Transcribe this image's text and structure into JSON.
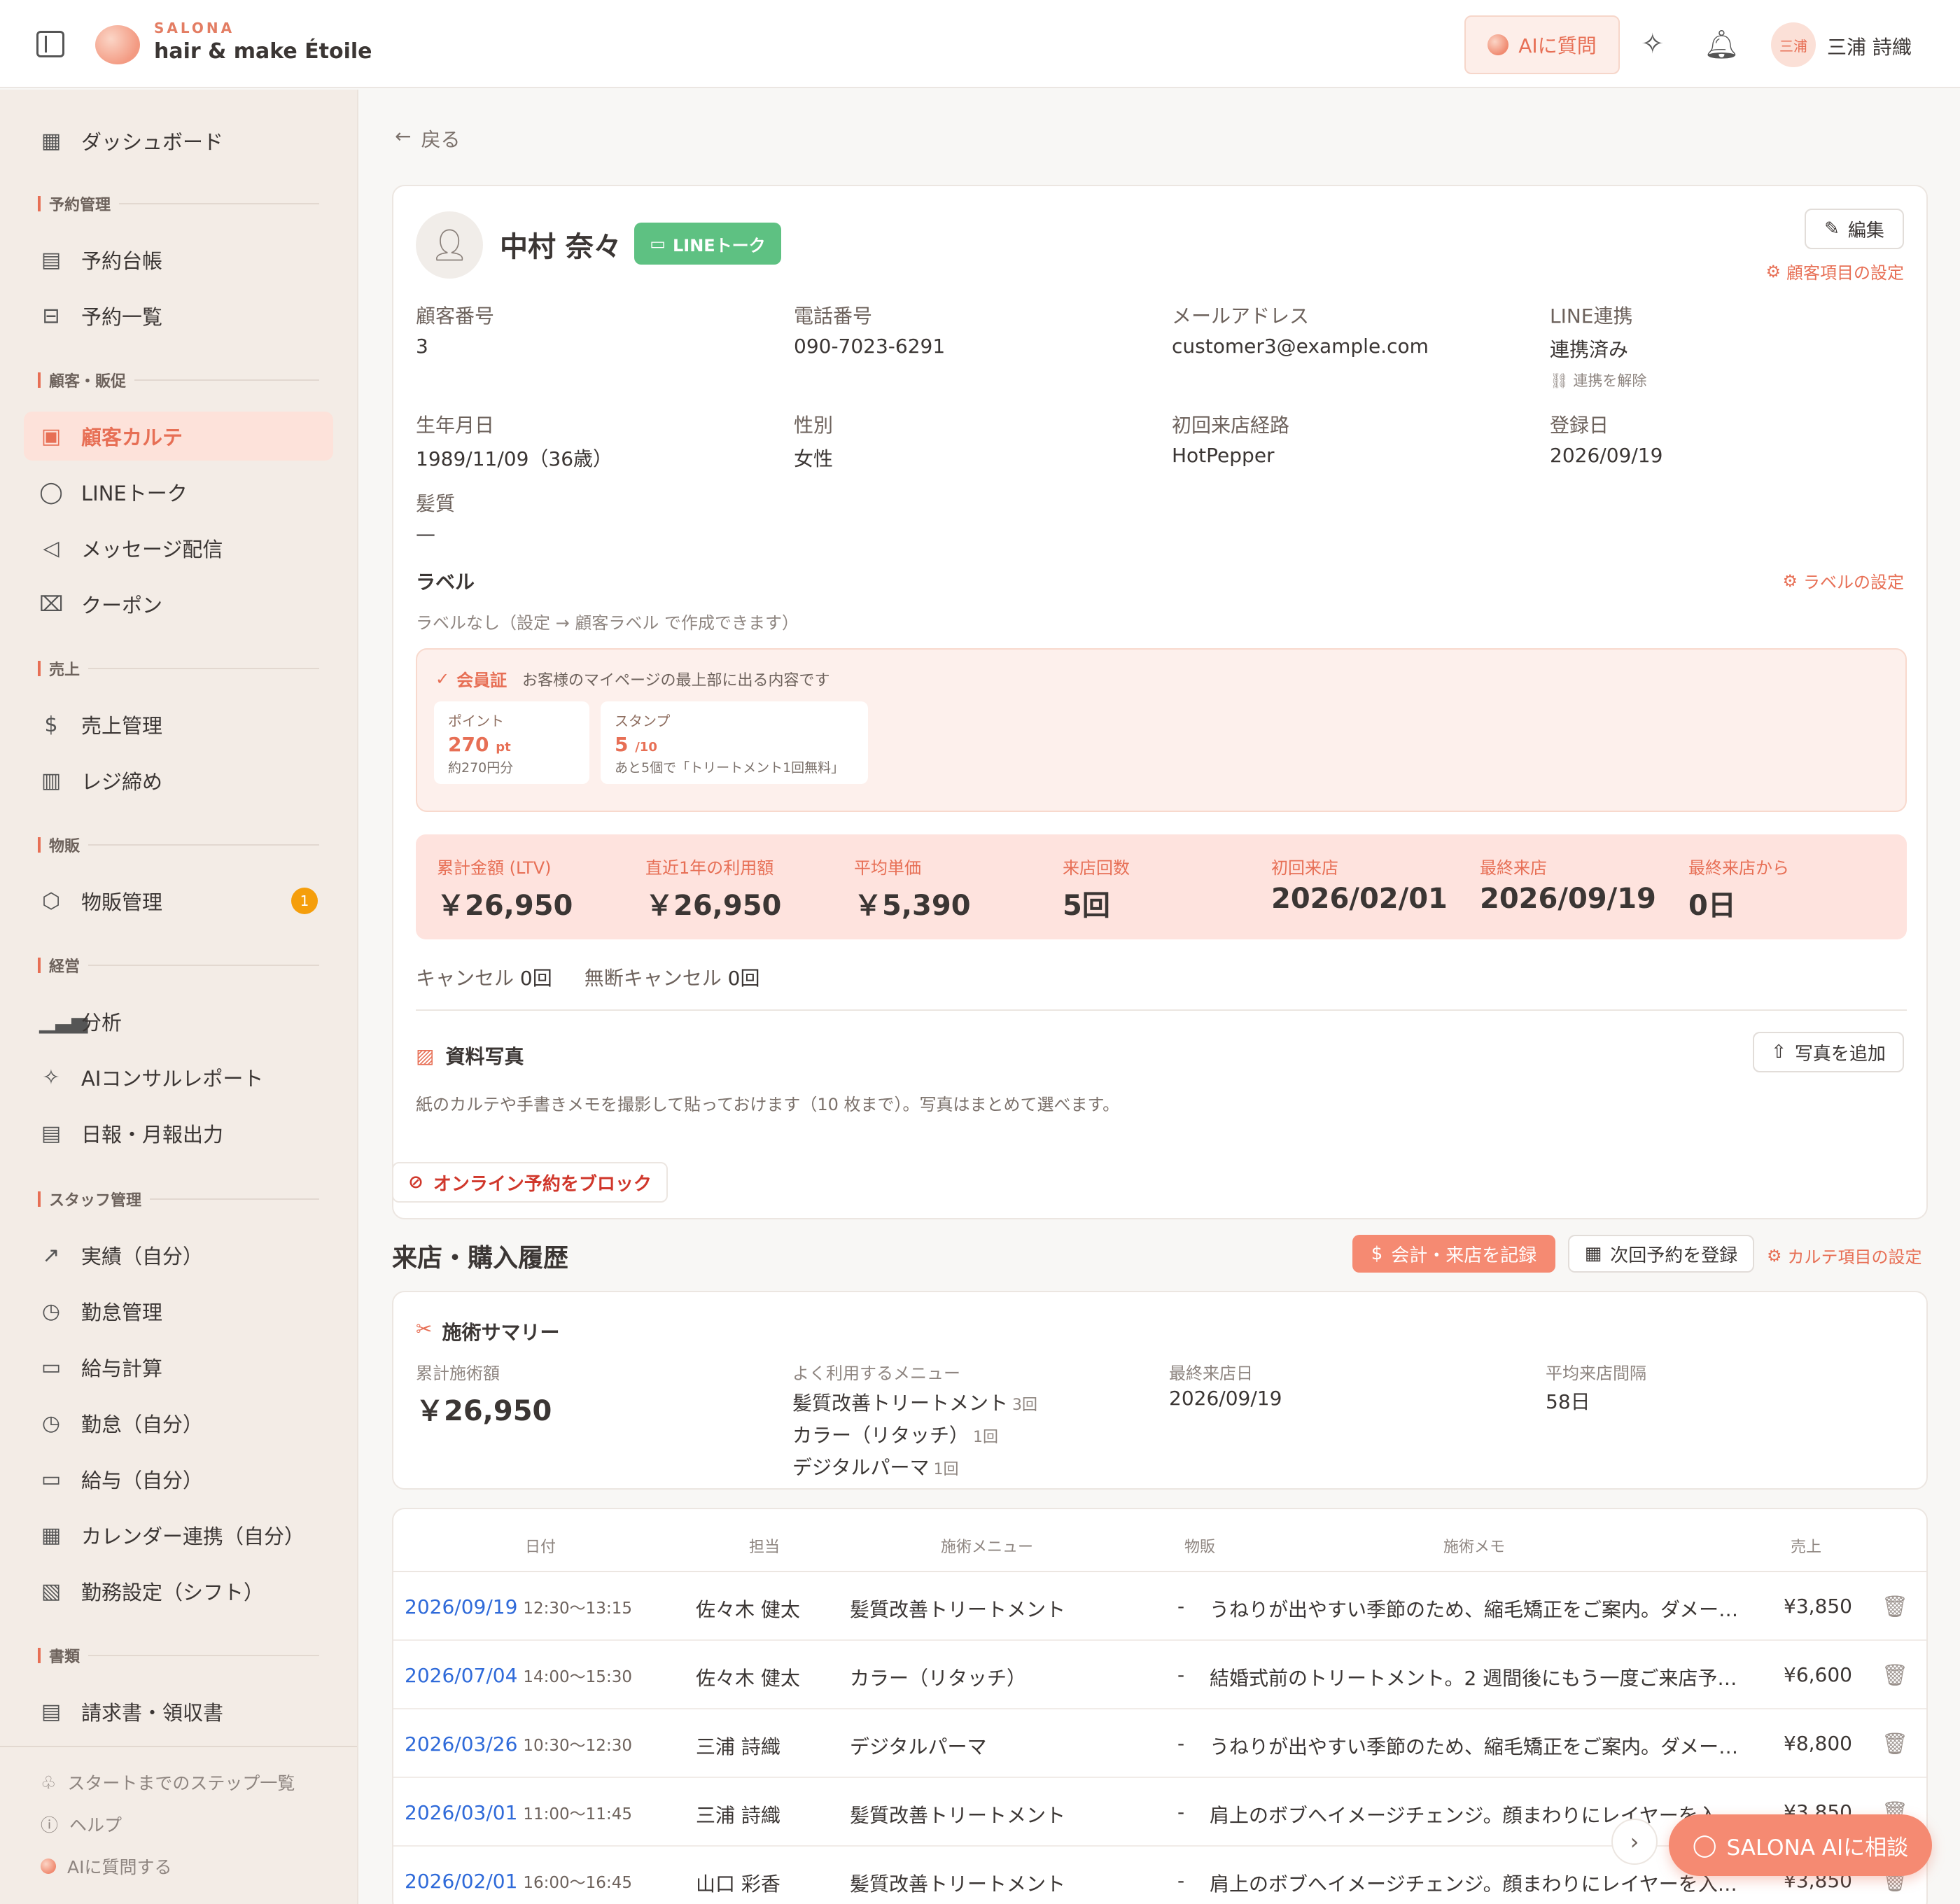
{
  "topbar": {
    "brand_small": "SALONA",
    "brand_name": "hair & make Étoile",
    "ai_ask_label": "AIに質問",
    "avatar_text": "三浦",
    "user_name": "三浦 詩織"
  },
  "sidebar": {
    "dashboard": "ダッシュボード",
    "sections": {
      "reservation": "予約管理",
      "customer": "顧客・販促",
      "sales": "売上",
      "goods": "物販",
      "management": "経営",
      "staff": "スタッフ管理",
      "documents": "書類"
    },
    "items": {
      "reservation_book": "予約台帳",
      "reservation_list": "予約一覧",
      "customer_karte": "顧客カルテ",
      "line_talk": "LINEトーク",
      "message": "メッセージ配信",
      "coupon": "クーポン",
      "sales_mgmt": "売上管理",
      "register_close": "レジ締め",
      "goods_mgmt": "物販管理",
      "goods_badge": "1",
      "analysis": "分析",
      "ai_report": "AIコンサルレポート",
      "daily_report": "日報・月報出力",
      "results": "実績（自分）",
      "attendance_mgmt": "勤怠管理",
      "payroll": "給与計算",
      "my_attendance": "勤怠（自分）",
      "my_salary": "給与（自分）",
      "calendar_sync": "カレンダー連携（自分）",
      "work_settings": "勤務設定（シフト）",
      "invoice": "請求書・領収書"
    },
    "footer": {
      "steps": "スタートまでのステップ一覧",
      "help": "ヘルプ",
      "ask_ai": "AIに質問する"
    }
  },
  "main": {
    "back_label": "戻る",
    "customer": {
      "name": "中村 奈々",
      "line_talk_btn": "LINEトーク",
      "edit_btn": "編集",
      "field_settings": "顧客項目の設定",
      "fields": {
        "customer_no_label": "顧客番号",
        "customer_no": "3",
        "phone_label": "電話番号",
        "phone": "090-7023-6291",
        "email_label": "メールアドレス",
        "email": "customer3@example.com",
        "line_label": "LINE連携",
        "line_status": "連携済み",
        "line_unlink": "連携を解除",
        "birth_label": "生年月日",
        "birth": "1989/11/09（36歳）",
        "gender_label": "性別",
        "gender": "女性",
        "route_label": "初回来店経路",
        "route": "HotPepper",
        "registered_label": "登録日",
        "registered": "2026/09/19",
        "hair_label": "髪質",
        "hair": "—"
      },
      "label_title": "ラベル",
      "label_settings": "ラベルの設定",
      "label_empty": "ラベルなし（設定 → 顧客ラベル で作成できます）",
      "membership": {
        "title": "会員証",
        "desc": "お客様のマイページの最上部に出る内容です",
        "points_label": "ポイント",
        "points_value": "270",
        "points_unit": "pt",
        "points_sub": "約270円分",
        "stamp_label": "スタンプ",
        "stamp_value": "5",
        "stamp_unit": "/10",
        "stamp_sub": "あと5個で「トリートメント1回無料」"
      },
      "stats": [
        {
          "label": "累計金額 (LTV)",
          "value": "￥26,950"
        },
        {
          "label": "直近1年の利用額",
          "value": "￥26,950"
        },
        {
          "label": "平均単価",
          "value": "￥5,390"
        },
        {
          "label": "来店回数",
          "value": "5回"
        },
        {
          "label": "初回来店",
          "value": "2026/02/01"
        },
        {
          "label": "最終来店",
          "value": "2026/09/19"
        },
        {
          "label": "最終来店から",
          "value": "0日"
        }
      ],
      "cancel_label": "キャンセル",
      "cancel_value": "0回",
      "noshow_label": "無断キャンセル",
      "noshow_value": "0回",
      "photo_title": "資料写真",
      "photo_add": "写真を追加",
      "photo_desc": "紙のカルテや手書きメモを撮影して貼っておけます（10 枚まで）。写真はまとめて選べます。"
    },
    "block_online": "オンライン予約をブロック",
    "history": {
      "title": "来店・購入履歴",
      "record_btn": "会計・来店を記録",
      "next_btn": "次回予約を登録",
      "karte_settings": "カルテ項目の設定"
    },
    "summary": {
      "title": "施術サマリー",
      "total_label": "累計施術額",
      "total": "￥26,950",
      "menu_label": "よく利用するメニュー",
      "menus": [
        {
          "name": "髪質改善トリートメント",
          "count": "3回"
        },
        {
          "name": "カラー（リタッチ）",
          "count": "1回"
        },
        {
          "name": "デジタルパーマ",
          "count": "1回"
        }
      ],
      "last_label": "最終来店日",
      "last": "2026/09/19",
      "interval_label": "平均来店間隔",
      "interval": "58日"
    },
    "table": {
      "headers": {
        "date": "日付",
        "staff": "担当",
        "menu": "施術メニュー",
        "goods": "物販",
        "memo": "施術メモ",
        "sales": "売上"
      },
      "rows": [
        {
          "date": "2026/09/19",
          "time": "12:30〜13:15",
          "staff": "佐々木 健太",
          "menu": "髪質改善トリートメント",
          "goods": "-",
          "memo": "うねりが出やすい季節のため、縮毛矯正をご案内。ダメー…",
          "sales": "¥3,850"
        },
        {
          "date": "2026/07/04",
          "time": "14:00〜15:30",
          "staff": "佐々木 健太",
          "menu": "カラー（リタッチ）",
          "goods": "-",
          "memo": "結婚式前のトリートメント。2 週間後にもう一度ご来店予…",
          "sales": "¥6,600"
        },
        {
          "date": "2026/03/26",
          "time": "10:30〜12:30",
          "staff": "三浦 詩織",
          "menu": "デジタルパーマ",
          "goods": "-",
          "memo": "うねりが出やすい季節のため、縮毛矯正をご案内。ダメー…",
          "sales": "¥8,800"
        },
        {
          "date": "2026/03/01",
          "time": "11:00〜11:45",
          "staff": "三浦 詩織",
          "menu": "髪質改善トリートメント",
          "goods": "-",
          "memo": "肩上のボブへイメージチェンジ。顔まわりにレイヤーを入…",
          "sales": "¥3,850"
        },
        {
          "date": "2026/02/01",
          "time": "16:00〜16:45",
          "staff": "山口 彩香",
          "menu": "髪質改善トリートメント",
          "goods": "-",
          "memo": "肩上のボブへイメージチェンジ。顔まわりにレイヤーを入…",
          "sales": "¥3,850"
        }
      ]
    },
    "ai_consult": "SALONA AIに相談"
  }
}
